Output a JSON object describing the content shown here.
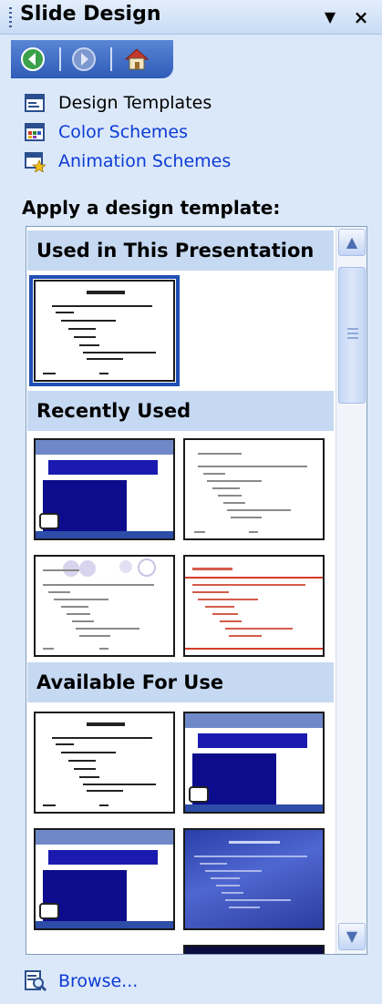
{
  "pane": {
    "title": "Slide Design",
    "dropdown_glyph": "▼",
    "close_glyph": "×"
  },
  "nav": {
    "back_icon": "back-arrow-icon",
    "forward_icon": "forward-arrow-icon",
    "home_icon": "home-icon"
  },
  "tasks": [
    {
      "label": "Design Templates",
      "icon": "design-templates-icon"
    },
    {
      "label": "Color Schemes",
      "icon": "color-schemes-icon"
    },
    {
      "label": "Animation Schemes",
      "icon": "animation-schemes-icon"
    }
  ],
  "gallery": {
    "heading": "Apply a design template:",
    "groups": [
      {
        "title": "Used in This Presentation"
      },
      {
        "title": "Recently Used"
      },
      {
        "title": "Available For Use"
      }
    ]
  },
  "browse": {
    "label": "Browse...",
    "icon": "browse-icon"
  },
  "colors": {
    "pane_bg": "#dbe8f9",
    "group_header_bg": "#c6d9f2",
    "link": "#0c3bd6",
    "selection": "#1f4fb3",
    "nav_blue": "#2e5cb8"
  }
}
